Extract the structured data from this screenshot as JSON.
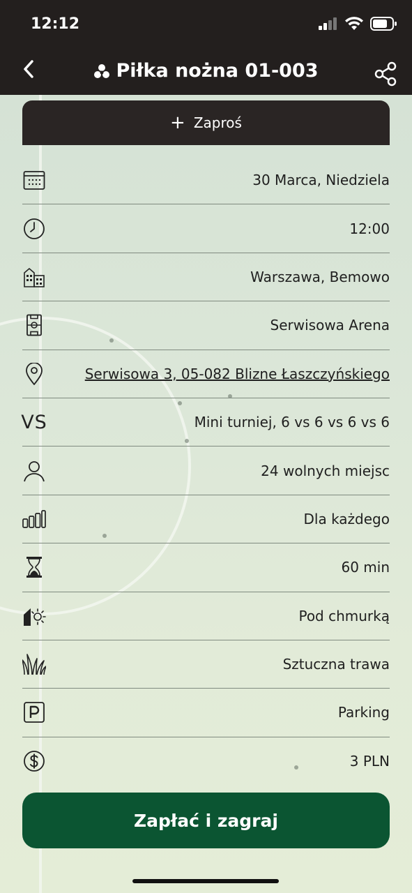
{
  "status_bar": {
    "time": "12:12"
  },
  "nav": {
    "title": "Piłka nożna 01-003"
  },
  "invite": {
    "label": "Zaproś"
  },
  "details": {
    "date": "30 Marca, Niedziela",
    "time": "12:00",
    "city": "Warszawa, Bemowo",
    "venue": "Serwisowa Arena",
    "address": "Serwisowa 3, 05-082 Blizne Łaszczyńskiego",
    "vs_label": "VS",
    "format": "Mini turniej, 6 vs 6 vs 6 vs 6",
    "spots": "24 wolnych miejsc",
    "level": "Dla każdego",
    "duration": "60 min",
    "location_type": "Pod chmurką",
    "surface": "Sztuczna trawa",
    "parking": "Parking",
    "price": "3 PLN"
  },
  "pay": {
    "label": "Zapłać i zagraj"
  },
  "colors": {
    "topbar": "#231f1e",
    "invite_bg": "#2a2524",
    "pay_bg": "#0b5532",
    "content_bg": "#d9e5d6"
  },
  "icons": [
    "back-icon",
    "football-icon",
    "share-icon",
    "calendar-icon",
    "clock-icon",
    "city-icon",
    "pitch-icon",
    "location-pin-icon",
    "user-icon",
    "level-bars-icon",
    "hourglass-icon",
    "outdoor-icon",
    "grass-icon",
    "parking-icon",
    "dollar-icon"
  ]
}
